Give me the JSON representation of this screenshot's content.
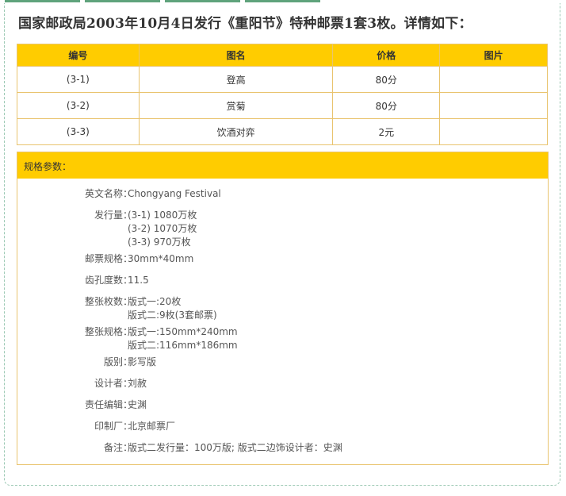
{
  "headline": "国家邮政局2003年10月4日发行《重阳节》特种邮票1套3枚。详情如下：",
  "table": {
    "headers": [
      "编号",
      "图名",
      "价格",
      "图片"
    ],
    "rows": [
      [
        "(3-1)",
        "登高",
        "80分",
        ""
      ],
      [
        "(3-2)",
        "赏菊",
        "80分",
        ""
      ],
      [
        "(3-3)",
        "饮酒对弈",
        "2元",
        ""
      ]
    ]
  },
  "spec": {
    "title": "规格参数：",
    "rows": [
      {
        "label": "英文名称：",
        "values": [
          "Chongyang Festival"
        ]
      },
      {
        "label": "发行量：",
        "values": [
          "(3-1) 1080万枚",
          "(3-2) 1070万枚",
          "(3-3) 970万枚"
        ]
      },
      {
        "label": "邮票规格：",
        "values": [
          "30mm*40mm"
        ]
      },
      {
        "label": "齿孔度数：",
        "values": [
          "11.5"
        ]
      },
      {
        "label": "整张枚数：",
        "values": [
          "版式一:20枚",
          "版式二:9枚(3套邮票)"
        ]
      },
      {
        "label": "整张规格：",
        "values": [
          "版式一:150mm*240mm",
          "版式二:116mm*186mm"
        ]
      },
      {
        "label": "版别：",
        "values": [
          "影写版"
        ]
      },
      {
        "label": "设计者：",
        "values": [
          "刘赦"
        ]
      },
      {
        "label": "责任编辑：",
        "values": [
          "史渊"
        ]
      },
      {
        "label": "印制厂：",
        "values": [
          "北京邮票厂"
        ]
      },
      {
        "label": "备注：",
        "values": [
          "版式二发行量：100万版; 版式二边饰设计者：史渊"
        ]
      }
    ]
  },
  "colors": {
    "header_fill": "#ffcc00",
    "border": "#e9c46f",
    "frame_dash": "#9cc9b4",
    "tab_green": "#5fa37c"
  }
}
